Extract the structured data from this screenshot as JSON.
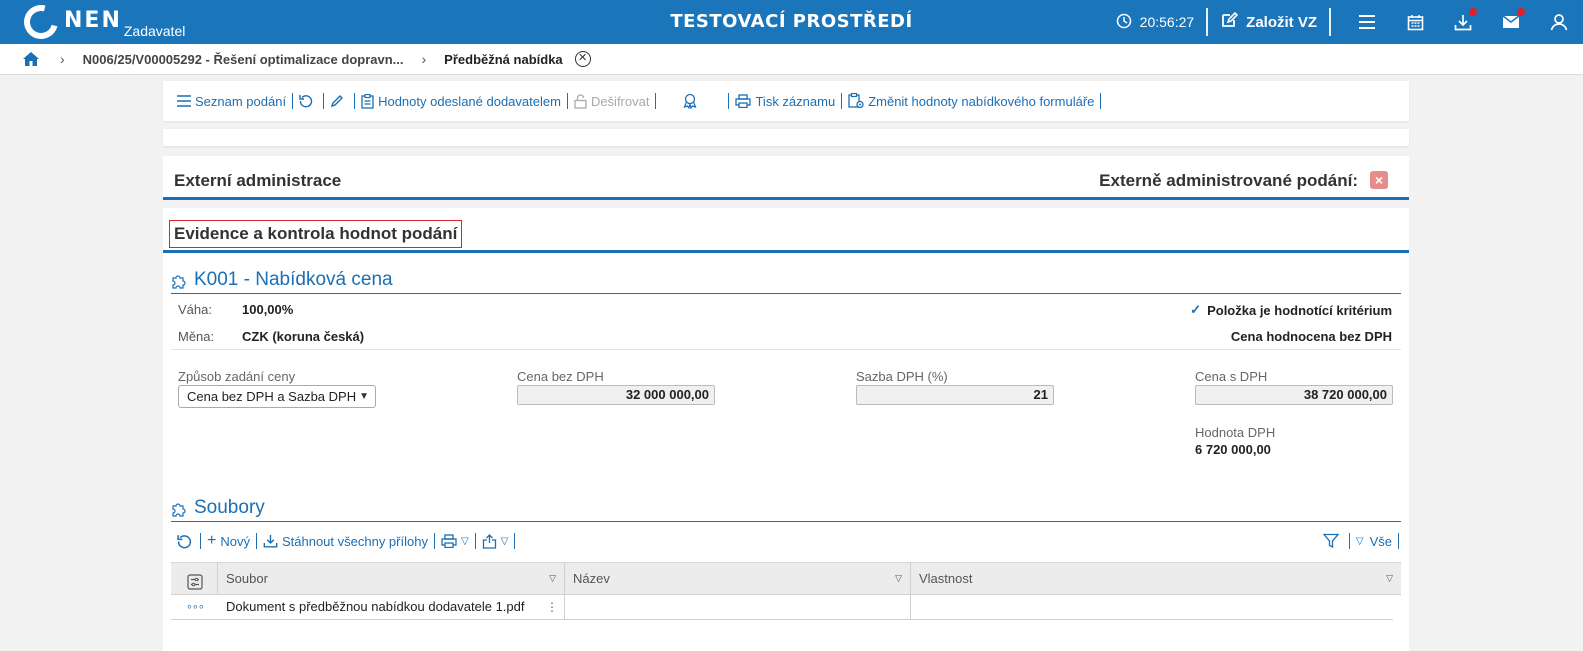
{
  "header": {
    "logo_text": "NEN",
    "logo_sub": "Zadavatel",
    "env_title": "TESTOVACÍ PROSTŘEDÍ",
    "time": "20:56:27",
    "create_label": "Založit VZ"
  },
  "breadcrumb": {
    "item1": "N006/25/V00005292 - Řešení optimalizace dopravn...",
    "item2": "Předběžná nabídka"
  },
  "toolbar": {
    "list_label": "Seznam podání",
    "sent_values_label": "Hodnoty odeslané dodavatelem",
    "decrypt_label": "Dešifrovat",
    "print_label": "Tisk záznamu",
    "change_values_label": "Změnit hodnoty nabídkového formuláře"
  },
  "external": {
    "title": "Externí administrace",
    "right_label": "Externě administrované podání:"
  },
  "evidence": {
    "title": "Evidence a kontrola hodnot podání"
  },
  "criterion": {
    "title": "K001 - Nabídková cena",
    "weight_label": "Váha:",
    "weight_value": "100,00%",
    "currency_label": "Měna:",
    "currency_value": "CZK (koruna česká)",
    "is_criterion_label": "Položka je hodnotící kritérium",
    "evaluated_label": "Cena hodnocena bez DPH",
    "mode_label": "Způsob zadání ceny",
    "mode_value": "Cena bez DPH a Sazba DPH",
    "price_ex_label": "Cena bez DPH",
    "price_ex_value": "32 000 000,00",
    "vat_rate_label": "Sazba DPH (%)",
    "vat_rate_value": "21",
    "price_inc_label": "Cena s DPH",
    "price_inc_value": "38 720 000,00",
    "vat_value_label": "Hodnota DPH",
    "vat_value": "6 720 000,00"
  },
  "files": {
    "title": "Soubory",
    "new_label": "Nový",
    "download_all_label": "Stáhnout všechny přílohy",
    "all_label": "Vše",
    "columns": [
      "Soubor",
      "Název",
      "Vlastnost"
    ],
    "rows": [
      {
        "soubor": "Dokument s předběžnou nabídkou dodavatele 1.pdf",
        "nazev": "",
        "vlastnost": ""
      }
    ]
  },
  "colors": {
    "primary": "#1a75bb",
    "link": "#1a6fb5",
    "badge_red": "#e3202a",
    "highlight_border": "#d9262c"
  }
}
